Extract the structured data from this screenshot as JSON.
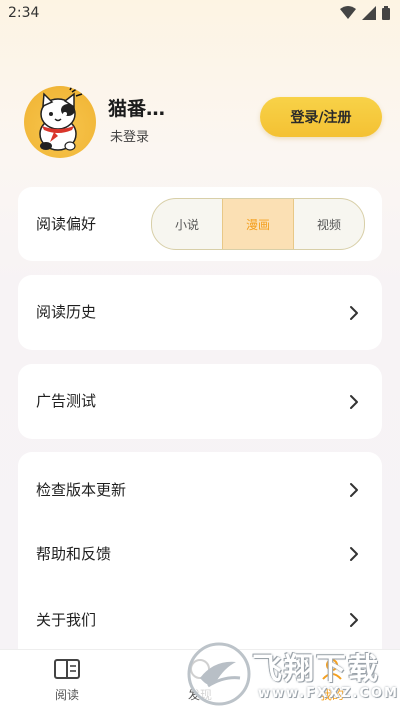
{
  "status_bar": {
    "time": "2:34"
  },
  "profile": {
    "username": "猫番…",
    "login_status": "未登录",
    "login_button": "登录/注册"
  },
  "reading_preference": {
    "label": "阅读偏好",
    "options": [
      "小说",
      "漫画",
      "视频"
    ],
    "selected": "漫画"
  },
  "menu": {
    "history": "阅读历史",
    "ad_test": "广告测试",
    "check_update": "检查版本更新",
    "help_feedback": "帮助和反馈",
    "about_us": "关于我们"
  },
  "bottom_nav": {
    "items": [
      "阅读",
      "发现",
      "我的"
    ],
    "active": "我的"
  },
  "watermark": {
    "text": "飞翔下载",
    "url": "www.FXXZ.COM"
  },
  "colors": {
    "accent": "#f4c133",
    "active_tab": "#f4a020"
  }
}
